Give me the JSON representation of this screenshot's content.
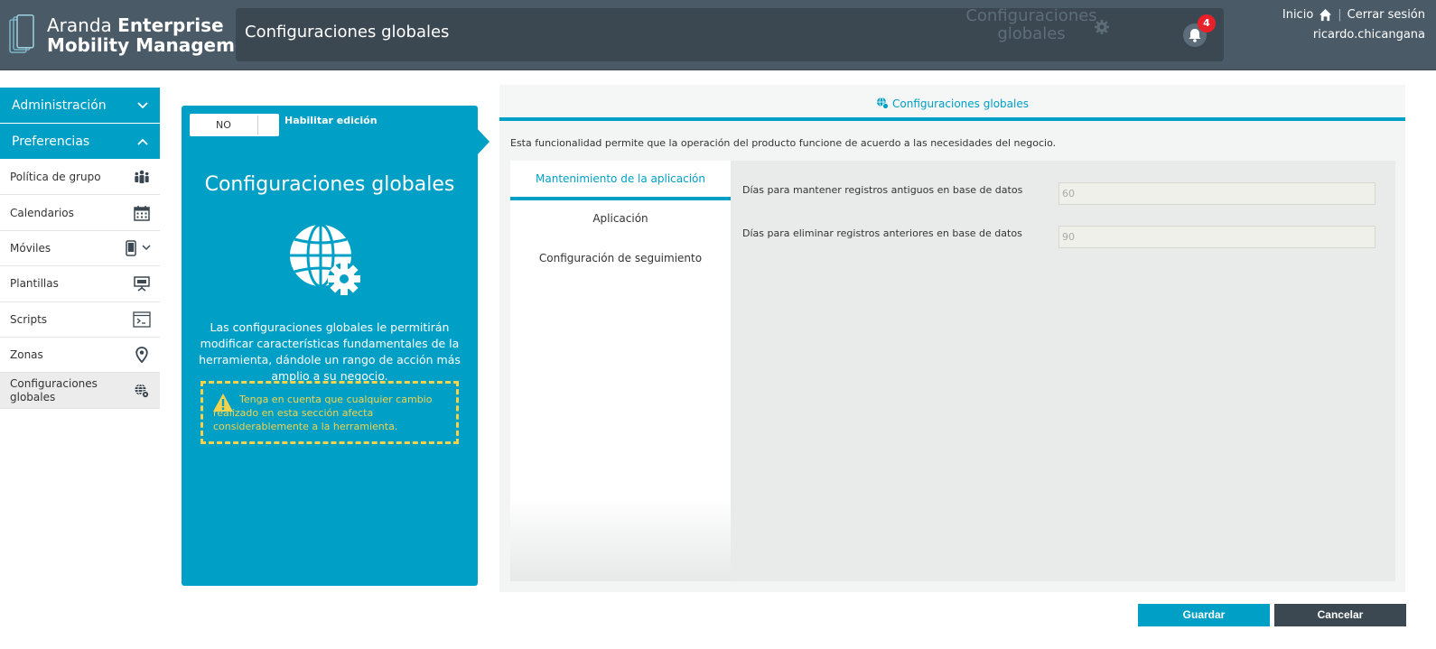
{
  "header": {
    "brand_light": "Aranda ",
    "brand_bold1": "Enterprise",
    "brand_bold2": "Mobility Management",
    "page_title": "Configuraciones globales",
    "ghost_title": "Configuraciones globales",
    "notification_count": "4",
    "home_link": "Inicio",
    "separator": "|",
    "logout_link": "Cerrar sesión",
    "username": "ricardo.chicangana"
  },
  "sidebar": {
    "sections": [
      {
        "label": "Administración",
        "icon": "chevron-down-icon"
      },
      {
        "label": "Preferencias",
        "icon": "chevron-up-icon"
      }
    ],
    "items": [
      {
        "label": "Política de grupo",
        "icon": "group-icon"
      },
      {
        "label": "Calendarios",
        "icon": "calendar-icon"
      },
      {
        "label": "Móviles",
        "icon": "mobile-icon"
      },
      {
        "label": "Plantillas",
        "icon": "presentation-icon"
      },
      {
        "label": "Scripts",
        "icon": "terminal-icon"
      },
      {
        "label": "Zonas",
        "icon": "location-pin-icon"
      },
      {
        "label": "Configuraciones globales",
        "icon": "globe-gear-icon"
      }
    ]
  },
  "info_panel": {
    "toggle_value": "NO",
    "toggle_label": "Habilitar edición",
    "title": "Configuraciones globales",
    "description": "Las configuraciones globales le permitirán modificar características fundamentales de la herramienta, dándole un rango de acción más amplio a su negocio.",
    "warning": "Tenga en cuenta que cualquier cambio realizado en esta sección afecta considerablemente a la herramienta."
  },
  "main": {
    "header_label": "Configuraciones globales",
    "description": "Esta funcionalidad permite que la operación del producto funcione de acuerdo a las necesidades del negocio.",
    "tabs": [
      {
        "label": "Mantenimiento de la aplicación"
      },
      {
        "label": "Aplicación"
      },
      {
        "label": "Configuración de seguimiento"
      }
    ],
    "fields": [
      {
        "label": "Días para mantener registros antiguos en base de datos",
        "value": "60"
      },
      {
        "label": "Días para eliminar registros anteriores en base de datos",
        "value": "90"
      }
    ]
  },
  "actions": {
    "save": "Guardar",
    "cancel": "Cancelar"
  },
  "colors": {
    "accent": "#00a0c6",
    "header_bg": "#4a5a66",
    "warning": "#f5d24b",
    "badge": "#e8202a"
  }
}
